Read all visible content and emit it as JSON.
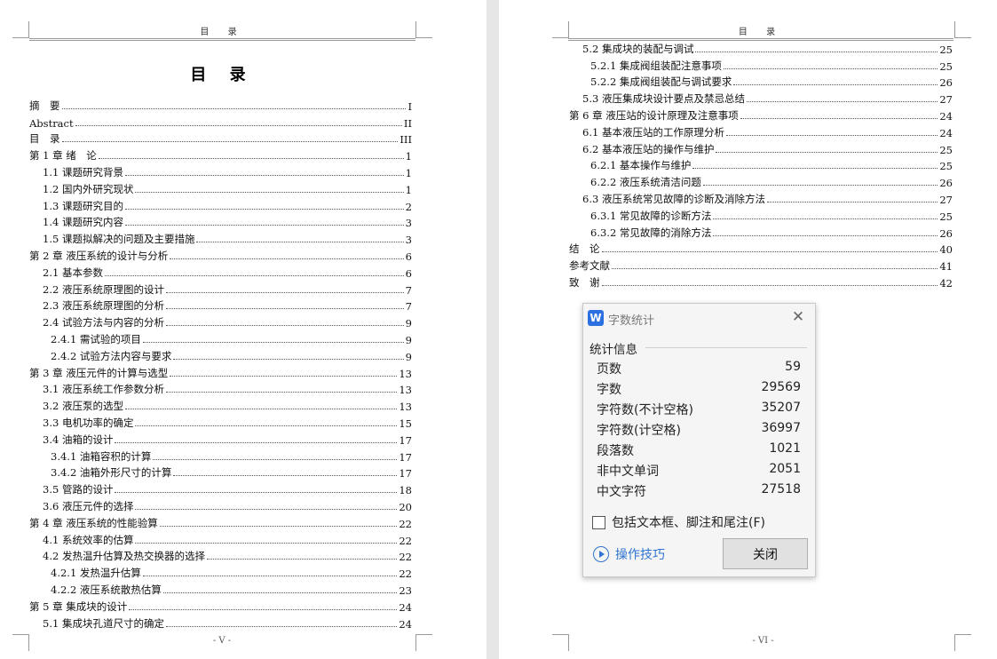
{
  "left_page": {
    "header": "目 录",
    "title": "目 录",
    "footer": "- V -",
    "toc": [
      {
        "label": "摘　要",
        "page": "I",
        "level": 1
      },
      {
        "label": "Abstract",
        "page": "II",
        "level": 1
      },
      {
        "label": "目　录",
        "page": "III",
        "level": 1
      },
      {
        "label": "第 1 章  绪　论",
        "page": "1",
        "level": 1
      },
      {
        "label": "1.1 课题研究背景",
        "page": "1",
        "level": 2
      },
      {
        "label": "1.2 国内外研究现状",
        "page": "1",
        "level": 2
      },
      {
        "label": "1.3 课题研究目的",
        "page": "2",
        "level": 2
      },
      {
        "label": "1.4 课题研究内容",
        "page": "3",
        "level": 2
      },
      {
        "label": "1.5 课题拟解决的问题及主要措施",
        "page": "3",
        "level": 2
      },
      {
        "label": "第 2 章  液压系统的设计与分析",
        "page": "6",
        "level": 1
      },
      {
        "label": "2.1 基本参数",
        "page": "6",
        "level": 2
      },
      {
        "label": "2.2 液压系统原理图的设计",
        "page": "7",
        "level": 2
      },
      {
        "label": "2.3 液压系统原理图的分析",
        "page": "7",
        "level": 2
      },
      {
        "label": "2.4 试验方法与内容的分析",
        "page": "9",
        "level": 2
      },
      {
        "label": "2.4.1 需试验的项目",
        "page": "9",
        "level": 3
      },
      {
        "label": "2.4.2 试验方法内容与要求",
        "page": "9",
        "level": 3
      },
      {
        "label": "第 3 章  液压元件的计算与选型",
        "page": "13",
        "level": 1
      },
      {
        "label": "3.1 液压系统工作参数分析",
        "page": "13",
        "level": 2
      },
      {
        "label": "3.2 液压泵的选型",
        "page": "13",
        "level": 2
      },
      {
        "label": "3.3 电机功率的确定",
        "page": "15",
        "level": 2
      },
      {
        "label": "3.4 油箱的设计",
        "page": "17",
        "level": 2
      },
      {
        "label": "3.4.1 油箱容积的计算",
        "page": "17",
        "level": 3
      },
      {
        "label": "3.4.2 油箱外形尺寸的计算",
        "page": "17",
        "level": 3
      },
      {
        "label": "3.5 管路的设计",
        "page": "18",
        "level": 2
      },
      {
        "label": "3.6 液压元件的选择",
        "page": "20",
        "level": 2
      },
      {
        "label": "第 4 章  液压系统的性能验算",
        "page": "22",
        "level": 1
      },
      {
        "label": "4.1 系统效率的估算",
        "page": "22",
        "level": 2
      },
      {
        "label": "4.2 发热温升估算及热交换器的选择",
        "page": "22",
        "level": 2
      },
      {
        "label": "4.2.1 发热温升估算",
        "page": "22",
        "level": 3
      },
      {
        "label": "4.2.2 液压系统散热估算",
        "page": "23",
        "level": 3
      },
      {
        "label": "第 5 章  集成块的设计",
        "page": "24",
        "level": 1
      },
      {
        "label": "5.1 集成块孔道尺寸的确定",
        "page": "24",
        "level": 2
      }
    ]
  },
  "right_page": {
    "header": "目 录",
    "footer": "- VI -",
    "toc": [
      {
        "label": "5.2 集成块的装配与调试",
        "page": "25",
        "level": 2
      },
      {
        "label": "5.2.1 集成阀组装配注意事项",
        "page": "25",
        "level": 3
      },
      {
        "label": "5.2.2 集成阀组装配与调试要求",
        "page": "26",
        "level": 3
      },
      {
        "label": "5.3 液压集成块设计要点及禁忌总结",
        "page": "27",
        "level": 2
      },
      {
        "label": "第 6 章  液压站的设计原理及注意事项",
        "page": "24",
        "level": 1
      },
      {
        "label": "6.1 基本液压站的工作原理分析",
        "page": "24",
        "level": 2
      },
      {
        "label": "6.2 基本液压站的操作与维护",
        "page": "25",
        "level": 2
      },
      {
        "label": "6.2.1 基本操作与维护",
        "page": "25",
        "level": 3
      },
      {
        "label": "6.2.2 液压系统清洁问题",
        "page": "26",
        "level": 3
      },
      {
        "label": "6.3 液压系统常见故障的诊断及消除方法",
        "page": "27",
        "level": 2
      },
      {
        "label": "6.3.1 常见故障的诊断方法",
        "page": "25",
        "level": 3
      },
      {
        "label": "6.3.2 常见故障的消除方法",
        "page": "26",
        "level": 3
      },
      {
        "label": "结　论",
        "page": "40",
        "level": 1
      },
      {
        "label": "参考文献",
        "page": "41",
        "level": 1
      },
      {
        "label": "致　谢",
        "page": "42",
        "level": 1
      }
    ]
  },
  "dialog": {
    "logo": "W",
    "title": "字数统计",
    "section": "统计信息",
    "stats": [
      {
        "label": "页数",
        "value": "59"
      },
      {
        "label": "字数",
        "value": "29569"
      },
      {
        "label": "字符数(不计空格)",
        "value": "35207"
      },
      {
        "label": "字符数(计空格)",
        "value": "36997"
      },
      {
        "label": "段落数",
        "value": "1021"
      },
      {
        "label": "非中文单词",
        "value": "2051"
      },
      {
        "label": "中文字符",
        "value": "27518"
      }
    ],
    "checkbox_label": "包括文本框、脚注和尾注(F)",
    "checkbox_checked": false,
    "tips_label": "操作技巧",
    "close_label": "关闭",
    "close_glyph": "✕",
    "accent_color": "#2f74d0"
  }
}
